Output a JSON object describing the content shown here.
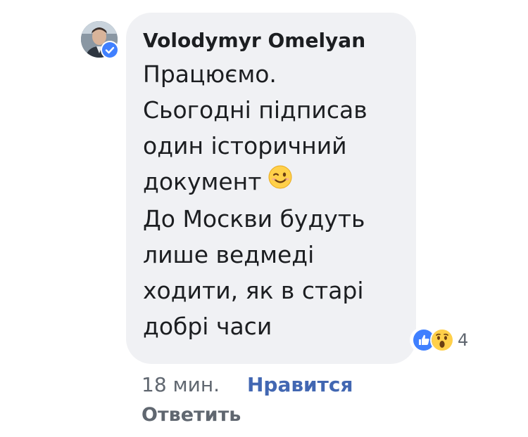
{
  "comment": {
    "author": "Volodymyr Omelyan",
    "avatar_icon": "user-photo",
    "verified_icon": "verified-check-icon",
    "message_lines": [
      "Працюємо.",
      "Сьогодні підписав",
      "один історичний",
      "документ",
      "До Москви будуть",
      "лише ведмеді",
      "ходити, як в старі",
      "добрі часи"
    ],
    "emoji": "winking-face",
    "reactions": {
      "types": [
        "like",
        "wow"
      ],
      "count": "4"
    },
    "timestamp": "18 мин.",
    "like_label": "Нравится",
    "reply_label": "Ответить"
  },
  "colors": {
    "bubble_bg": "#f0f1f4",
    "text": "#1c1e21",
    "meta_text": "#606770",
    "link_blue": "#4267b2",
    "verified_blue": "#4080ff"
  }
}
